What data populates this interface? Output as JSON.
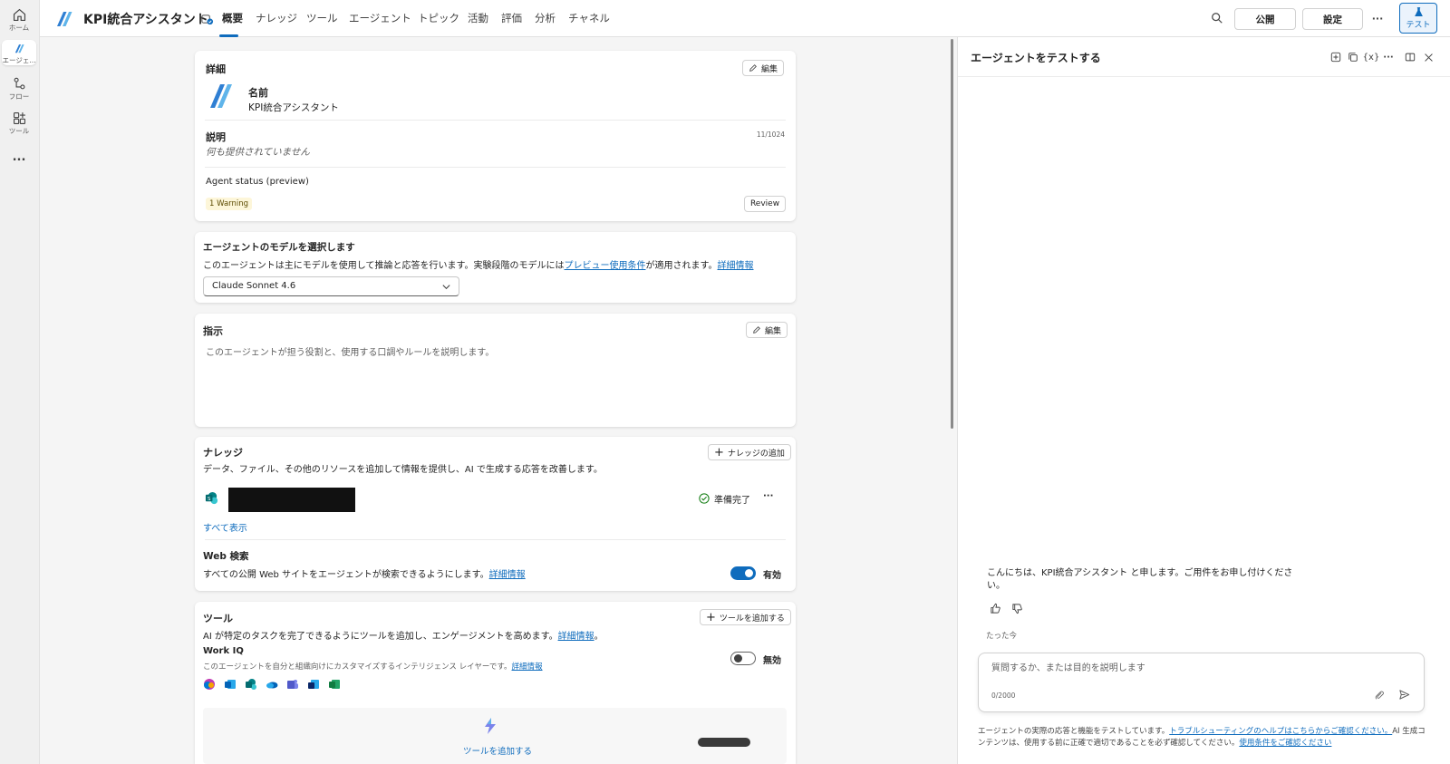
{
  "rail": {
    "items": [
      {
        "label": "ホーム",
        "icon": "home-icon"
      },
      {
        "label": "エージェ...",
        "icon": "agent-icon"
      },
      {
        "label": "フロー",
        "icon": "flow-icon"
      },
      {
        "label": "ツール",
        "icon": "tools-icon"
      },
      {
        "label": "...",
        "icon": "more-icon"
      }
    ]
  },
  "header": {
    "title": "KPI統合アシスタント",
    "tabs": [
      "概要",
      "ナレッジ",
      "ツール",
      "エージェント",
      "トピック",
      "活動",
      "評価",
      "分析",
      "チャネル"
    ],
    "publish": "公開",
    "settings": "設定",
    "more": "···",
    "test": "テスト"
  },
  "details": {
    "heading": "詳細",
    "edit": "編集",
    "name_label": "名前",
    "name_value": "KPI統合アシスタント",
    "desc_label": "説明",
    "desc_count": "11/1024",
    "desc_value": "何も提供されていません",
    "status_label": "Agent status (preview)",
    "warning": "1 Warning",
    "review": "Review"
  },
  "model": {
    "heading": "エージェントのモデルを選択します",
    "desc_pre": "このエージェントは主にモデルを使用して推論と応答を行います。実験段階のモデルには",
    "desc_link": "プレビュー使用条件",
    "desc_post": "が適用されます。",
    "learn_more": "詳細情報",
    "selected": "Claude Sonnet 4.6"
  },
  "instructions": {
    "heading": "指示",
    "edit": "編集",
    "placeholder": "このエージェントが担う役割と、使用する口調やルールを説明します。"
  },
  "knowledge": {
    "heading": "ナレッジ",
    "add": "ナレッジの追加",
    "desc": "データ、ファイル、その他のリソースを追加して情報を提供し、AI で生成する応答を改善します。",
    "item_status": "準備完了",
    "item_more": "···",
    "show_all": "すべて表示",
    "web_heading": "Web 検索",
    "web_desc": "すべての公開 Web サイトをエージェントが検索できるようにします。",
    "web_link": "詳細情報",
    "web_state": "有効"
  },
  "tools": {
    "heading": "ツール",
    "add": "ツールを追加する",
    "desc": "AI が特定のタスクを完了できるようにツールを追加し、エンゲージメントを高めます。",
    "desc_link": "詳細情報",
    "desc_end": "。",
    "workiq_heading": "Work IQ",
    "workiq_desc": "このエージェントを自分と組織向けにカスタマイズするインテリジェンス レイヤーです。",
    "workiq_link": "詳細情報",
    "workiq_state": "無効",
    "add_tool_cta": "ツールを追加する",
    "app_icons": [
      "copilot-icon",
      "outlook-icon",
      "sharepoint-icon",
      "onedrive-icon",
      "teams-icon",
      "exchange-icon",
      "excel-icon"
    ]
  },
  "test_panel": {
    "title": "エージェントをテストする",
    "greeting": "こんにちは、KPI統合アシスタント と申します。ご用件をお申し付けください。",
    "timestamp": "たった今",
    "input_placeholder": "質問するか、または目的を説明します",
    "counter": "0/2000",
    "footer_1": "エージェントの実際の応答と機能をテストしています。",
    "footer_link_1": "トラブルシューティングのヘルプはこちらからご確認ください。",
    "footer_2": "AI 生成コンテンツは、使用する前に正確で適切であることを必ず確認してください。",
    "footer_link_2": "使用条件をご確認ください"
  },
  "colors": {
    "accent": "#0f6cbd",
    "warning_bg": "#fdf6d9",
    "success": "#107c10"
  }
}
